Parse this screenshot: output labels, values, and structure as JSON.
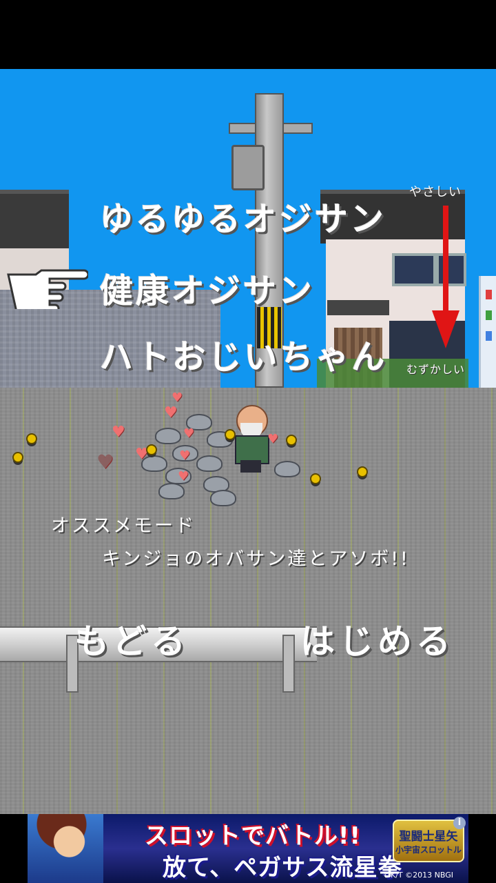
{
  "menu": {
    "options": [
      {
        "label": "ゆるゆるオジサン"
      },
      {
        "label": "健康オジサン"
      },
      {
        "label": "ハトおじいちゃん"
      }
    ],
    "selected_index": 1,
    "difficulty_easy": "やさしい",
    "difficulty_hard": "むずかしい"
  },
  "recommend": {
    "title": "オススメモード",
    "text": "キンジョのオバサン達とアソボ!!"
  },
  "buttons": {
    "back": "もどる",
    "start": "はじめる"
  },
  "ad": {
    "line1": "スロットでバトル!!",
    "line2": "放て、ペガサス流星拳",
    "logo_line1": "聖闘士星矢",
    "logo_line2": "小宇宙スロットル",
    "copyright": "©K/T  ©2013 NBGI",
    "info_icon": "i"
  },
  "colors": {
    "sky": "#1196f0",
    "road": "#8d8d8d",
    "arrow": "#e01515"
  }
}
